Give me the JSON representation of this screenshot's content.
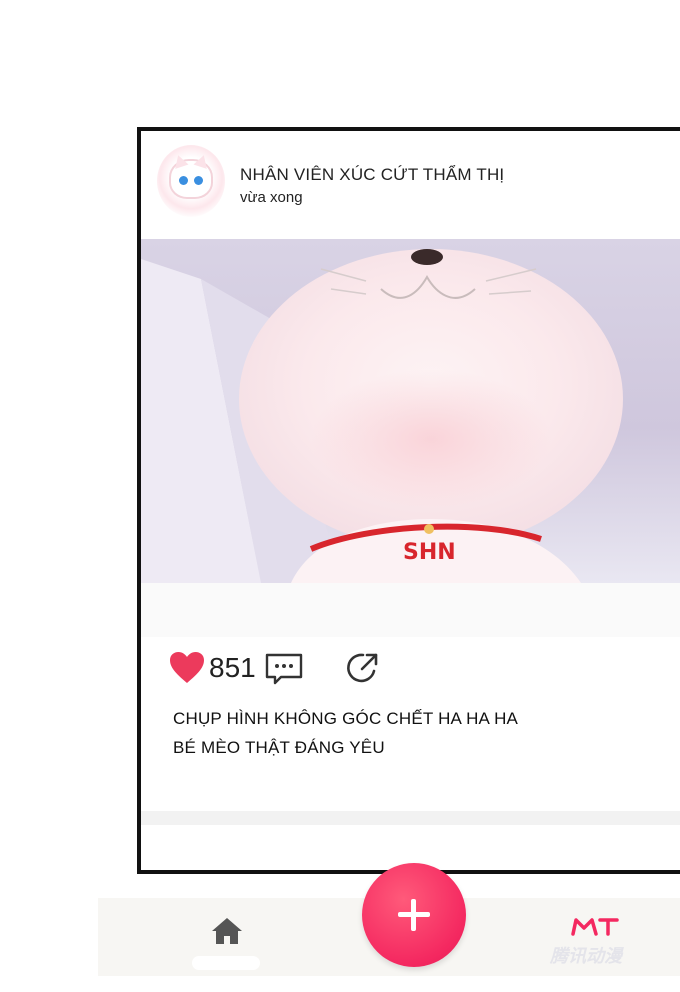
{
  "post": {
    "username": "NHÂN VIÊN XÚC CỨT THẨM THỊ",
    "timestamp": "vừa xong",
    "likes": "851",
    "caption": [
      "CHỤP HÌNH KHÔNG GÓC CHẾT HA HA HA",
      "BÉ MÈO THẬT ĐÁNG YÊU"
    ],
    "collar_tag": "SHN"
  },
  "icons": {
    "avatar": "cat-avatar",
    "like": "heart-icon",
    "comment": "comment-icon",
    "share": "share-icon",
    "home": "home-icon",
    "profile": "profile-icon",
    "create": "plus-icon"
  },
  "bottom_nav": {
    "watermark": "腾讯动漫"
  },
  "colors": {
    "accent": "#f42860",
    "heart": "#ec3a5c",
    "frame": "#111111",
    "collar": "#d8262d",
    "home_icon": "#555555"
  }
}
